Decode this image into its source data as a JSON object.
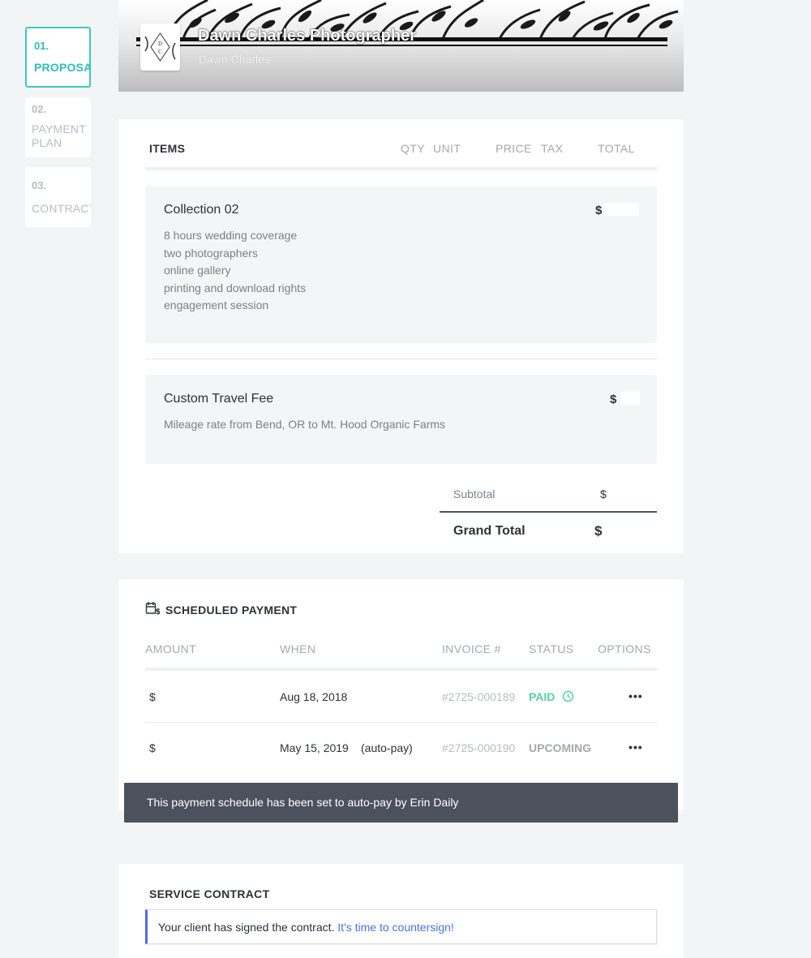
{
  "steps": [
    {
      "num": "01.",
      "label": "PROPOSAL"
    },
    {
      "num": "02.",
      "label1": "PAYMENT",
      "label2": "PLAN"
    },
    {
      "num": "03.",
      "label": "CONTRACT"
    }
  ],
  "header": {
    "studio_name": "Dawn Charles Photographer",
    "owner_name": "Dawn Charles",
    "logo_letters": [
      "D",
      "C"
    ]
  },
  "items": {
    "title": "ITEMS",
    "columns": [
      "QTY",
      "UNIT",
      "PRICE",
      "TAX",
      "TOTAL"
    ],
    "list": [
      {
        "name": "Collection 02",
        "price": "$",
        "details": [
          "8 hours wedding coverage",
          "two photographers",
          "online gallery",
          "printing and download rights",
          "engagement session"
        ]
      },
      {
        "name": "Custom Travel Fee",
        "price": "$",
        "details": [
          "Mileage rate from Bend, OR to Mt. Hood Organic Farms"
        ]
      }
    ],
    "subtotal_label": "Subtotal",
    "subtotal_value": "$",
    "grand_total_label": "Grand Total",
    "grand_total_value": "$"
  },
  "payments": {
    "title": "SCHEDULED PAYMENT",
    "icon": "calendar-dollar-icon",
    "columns": [
      "AMOUNT",
      "WHEN",
      "INVOICE #",
      "STATUS",
      "OPTIONS"
    ],
    "rows": [
      {
        "amount": "$",
        "when": "Aug 18, 2018",
        "note": "",
        "invoice": "#2725-000189",
        "status": "PAID",
        "options": "•••"
      },
      {
        "amount": "$",
        "when": "May 15, 2019",
        "note": "(auto-pay)",
        "invoice": "#2725-000190",
        "status": "UPCOMING",
        "options": "•••"
      }
    ],
    "notice": "This payment schedule has been set to auto-pay by Erin Daily"
  },
  "contract": {
    "title": "SERVICE CONTRACT",
    "message": "Your client has signed the contract.",
    "link": "It's time to countersign!"
  },
  "colors": {
    "accent_teal": "#3cc9c5",
    "paid_green": "#57d19a",
    "link_blue": "#4a73e0",
    "notice_bg": "#4c525d"
  }
}
